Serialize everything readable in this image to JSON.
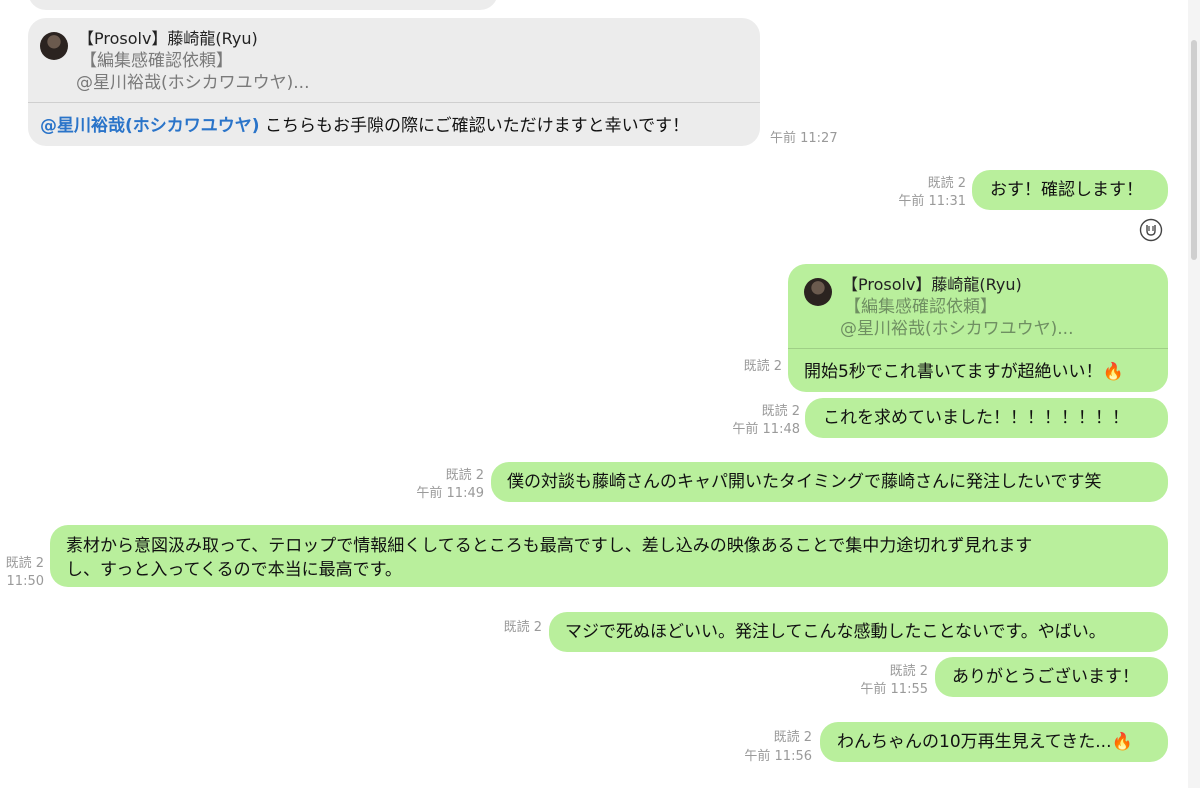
{
  "messages": {
    "m0": {
      "text": "",
      "note": ""
    },
    "m1": {
      "quote_name": "【Prosolv】藤崎龍(Ryu)",
      "quote_title": "【編集感確認依頼】",
      "quote_snippet": "@星川裕哉(ホシカワユウヤ)...",
      "mention": "@星川裕哉(ホシカワユウヤ)",
      "text": " こちらもお手隙の際にご確認いただけますと幸いです！",
      "time": "午前 11:27"
    },
    "m2": {
      "read": "既読 2",
      "time": "午前 11:31",
      "text": "おす！確認します！"
    },
    "m3": {
      "quote_name": "【Prosolv】藤崎龍(Ryu)",
      "quote_title": "【編集感確認依頼】",
      "quote_snippet": "@星川裕哉(ホシカワユウヤ)...",
      "text": "開始5秒でこれ書いてますが超絶いい！",
      "emoji": "🔥",
      "read": "既読 2"
    },
    "m4": {
      "read": "既読 2",
      "time": "午前 11:48",
      "text": "これを求めていました！！！！！！！！"
    },
    "m5": {
      "read": "既読 2",
      "time": "午前 11:49",
      "text": "僕の対談も藤崎さんのキャパ開いたタイミングで藤崎さんに発注したいです笑"
    },
    "m6": {
      "read": "既読 2",
      "time": "11:50",
      "line1": "素材から意図汲み取って、テロップで情報細くしてるところも最高ですし、差し込みの映像あることで集中力途切れず見れます",
      "line2": "し、すっと入ってくるので本当に最高です。"
    },
    "m7": {
      "read": "既読 2",
      "text": "マジで死ぬほどいい。発注してこんな感動したことないです。やばい。"
    },
    "m8": {
      "read": "既読 2",
      "time": "午前 11:55",
      "text": "ありがとうございます！"
    },
    "m9": {
      "read": "既読 2",
      "time": "午前 11:56",
      "text": "わんちゃんの10万再生見えてきた...",
      "emoji": "🔥"
    }
  },
  "icons": {
    "reaction": "clapping-hands-reaction-icon",
    "avatar": "sender-avatar"
  },
  "colors": {
    "green_bubble": "#b9ef9c",
    "gray_bubble": "#ececec",
    "mention": "#2a74c9",
    "meta": "#9a9a9a"
  }
}
